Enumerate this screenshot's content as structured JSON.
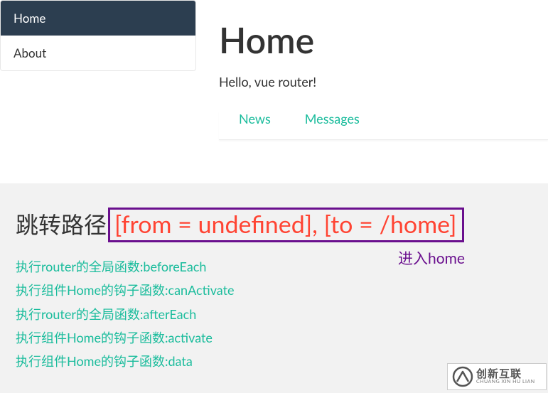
{
  "sidebar": {
    "items": [
      {
        "label": "Home",
        "active": true
      },
      {
        "label": "About",
        "active": false
      }
    ]
  },
  "main": {
    "title": "Home",
    "greeting": "Hello, vue router!",
    "subtabs": [
      {
        "label": "News"
      },
      {
        "label": "Messages"
      }
    ]
  },
  "log": {
    "route_label": "跳转路径",
    "route_text": "[from = undefined], [to = /home]",
    "enter_note": "进入home",
    "lines": [
      "执行router的全局函数:beforeEach",
      "执行组件Home的钩子函数:canActivate",
      "执行router的全局函数:afterEach",
      "执行组件Home的钩子函数:activate",
      "执行组件Home的钩子函数:data"
    ]
  },
  "watermark": {
    "brand_main": "创新互联",
    "brand_sub": "CHUANG XIN HU LIAN"
  }
}
